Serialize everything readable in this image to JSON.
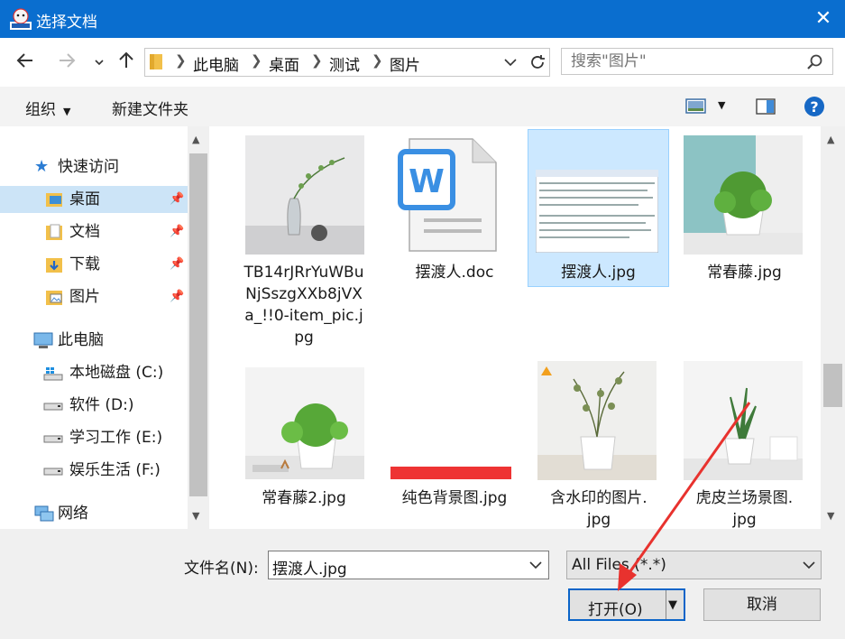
{
  "window": {
    "title": "选择文档",
    "close_glyph": "✕"
  },
  "address": {
    "crumbs": [
      "此电脑",
      "桌面",
      "测试",
      "图片"
    ],
    "search_placeholder": "搜索\"图片\""
  },
  "toolbar": {
    "organize": "组织",
    "new_folder": "新建文件夹"
  },
  "nav": {
    "quick_access": "快速访问",
    "desktop": "桌面",
    "documents": "文档",
    "downloads": "下载",
    "pictures": "图片",
    "this_pc": "此电脑",
    "drive_c": "本地磁盘 (C:)",
    "drive_d": "软件 (D:)",
    "drive_e": "学习工作 (E:)",
    "drive_f": "娱乐生活 (F:)",
    "network": "网络"
  },
  "files": [
    {
      "line1": "TB14rJRrYuWBu",
      "line2": "NjSszgXXb8jVX",
      "line3": "a_!!0-item_pic.j",
      "line4": "pg"
    },
    {
      "line1": "摆渡人.doc"
    },
    {
      "line1": "摆渡人.jpg",
      "selected": true
    },
    {
      "line1": "常春藤.jpg"
    },
    {
      "line1": "常春藤2.jpg"
    },
    {
      "line1": "纯色背景图.jpg"
    },
    {
      "line1": "含水印的图片.",
      "line2": "jpg"
    },
    {
      "line1": "虎皮兰场景图.",
      "line2": "jpg"
    }
  ],
  "bottom": {
    "filename_label": "文件名(N):",
    "filename_value": "摆渡人.jpg",
    "filter_value": "All Files (*.*)",
    "open_label": "打开(O)",
    "cancel_label": "取消"
  },
  "colors": {
    "titlebar": "#0a6ecf",
    "selection": "#cce4f7",
    "annotation_arrow": "#e8322e"
  }
}
